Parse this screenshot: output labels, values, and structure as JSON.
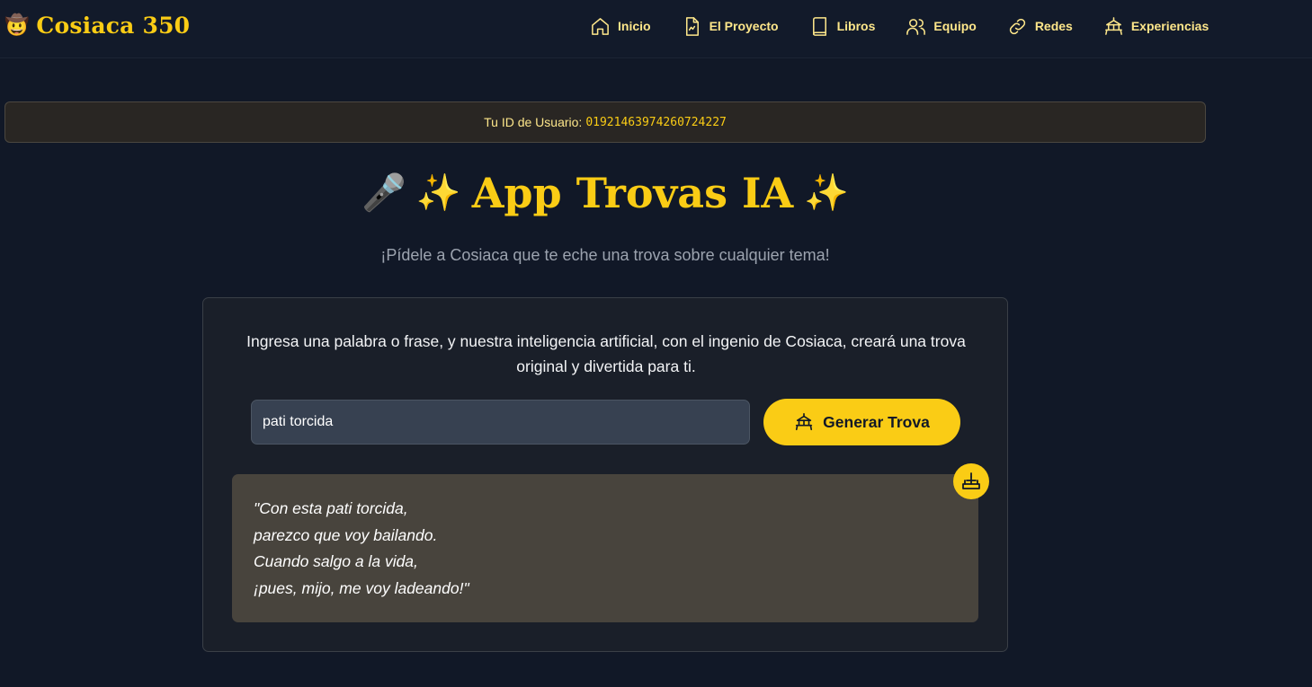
{
  "header": {
    "brand_emoji": "🤠",
    "brand_title": "Cosiaca 350",
    "nav": [
      {
        "label": "Inicio",
        "icon": "home-icon"
      },
      {
        "label": "El Proyecto",
        "icon": "document-icon"
      },
      {
        "label": "Libros",
        "icon": "book-icon"
      },
      {
        "label": "Equipo",
        "icon": "users-icon"
      },
      {
        "label": "Redes",
        "icon": "link-icon"
      },
      {
        "label": "Experiencias",
        "icon": "carousel-icon"
      }
    ]
  },
  "user_banner": {
    "label": "Tu ID de Usuario:",
    "user_id": "01921463974260724227"
  },
  "title": {
    "left_emojis": "🎤 ✨",
    "text": "App Trovas IA",
    "right_emoji": "✨"
  },
  "subtitle": "¡Pídele a Cosiaca que te eche una trova sobre cualquier tema!",
  "card": {
    "intro": "Ingresa una palabra o frase, y nuestra inteligencia artificial, con el ingenio de Cosiaca, creará una trova original y divertida para ti.",
    "input_value": "pati torcida",
    "generate_label": "Generar Trova",
    "trova_lines": [
      "\"Con esta pati torcida,",
      "parezco que voy bailando.",
      "Cuando salgo a la vida,",
      "¡pues, mijo, me voy ladeando!\""
    ]
  },
  "colors": {
    "background": "#111827",
    "accent": "#facc15",
    "nav_text": "#fde68a",
    "trova_box": "#48443d"
  }
}
